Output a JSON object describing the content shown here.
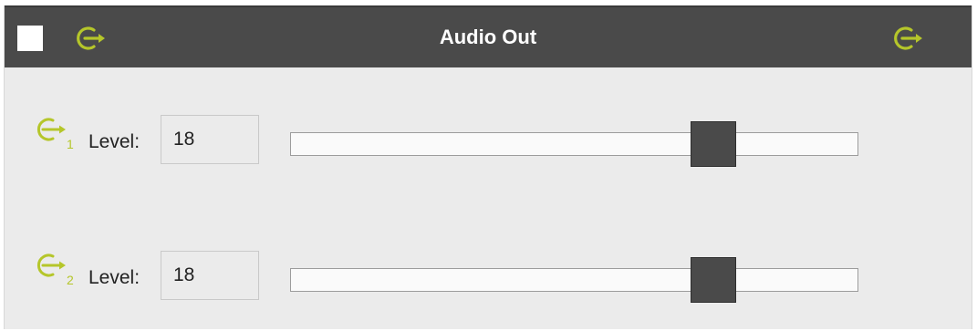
{
  "window": {
    "title": "Audio Out",
    "accent_color": "#b5c62a",
    "titlebar_color": "#4a4a4a",
    "left_icon": "output-arrow-icon",
    "right_icon": "output-arrow-icon"
  },
  "channels": [
    {
      "number": "1",
      "label": "Level:",
      "value": "18",
      "icon": "output-arrow-icon",
      "slider_fraction": 0.746
    },
    {
      "number": "2",
      "label": "Level:",
      "value": "18",
      "icon": "output-arrow-icon",
      "slider_fraction": 0.746
    }
  ]
}
